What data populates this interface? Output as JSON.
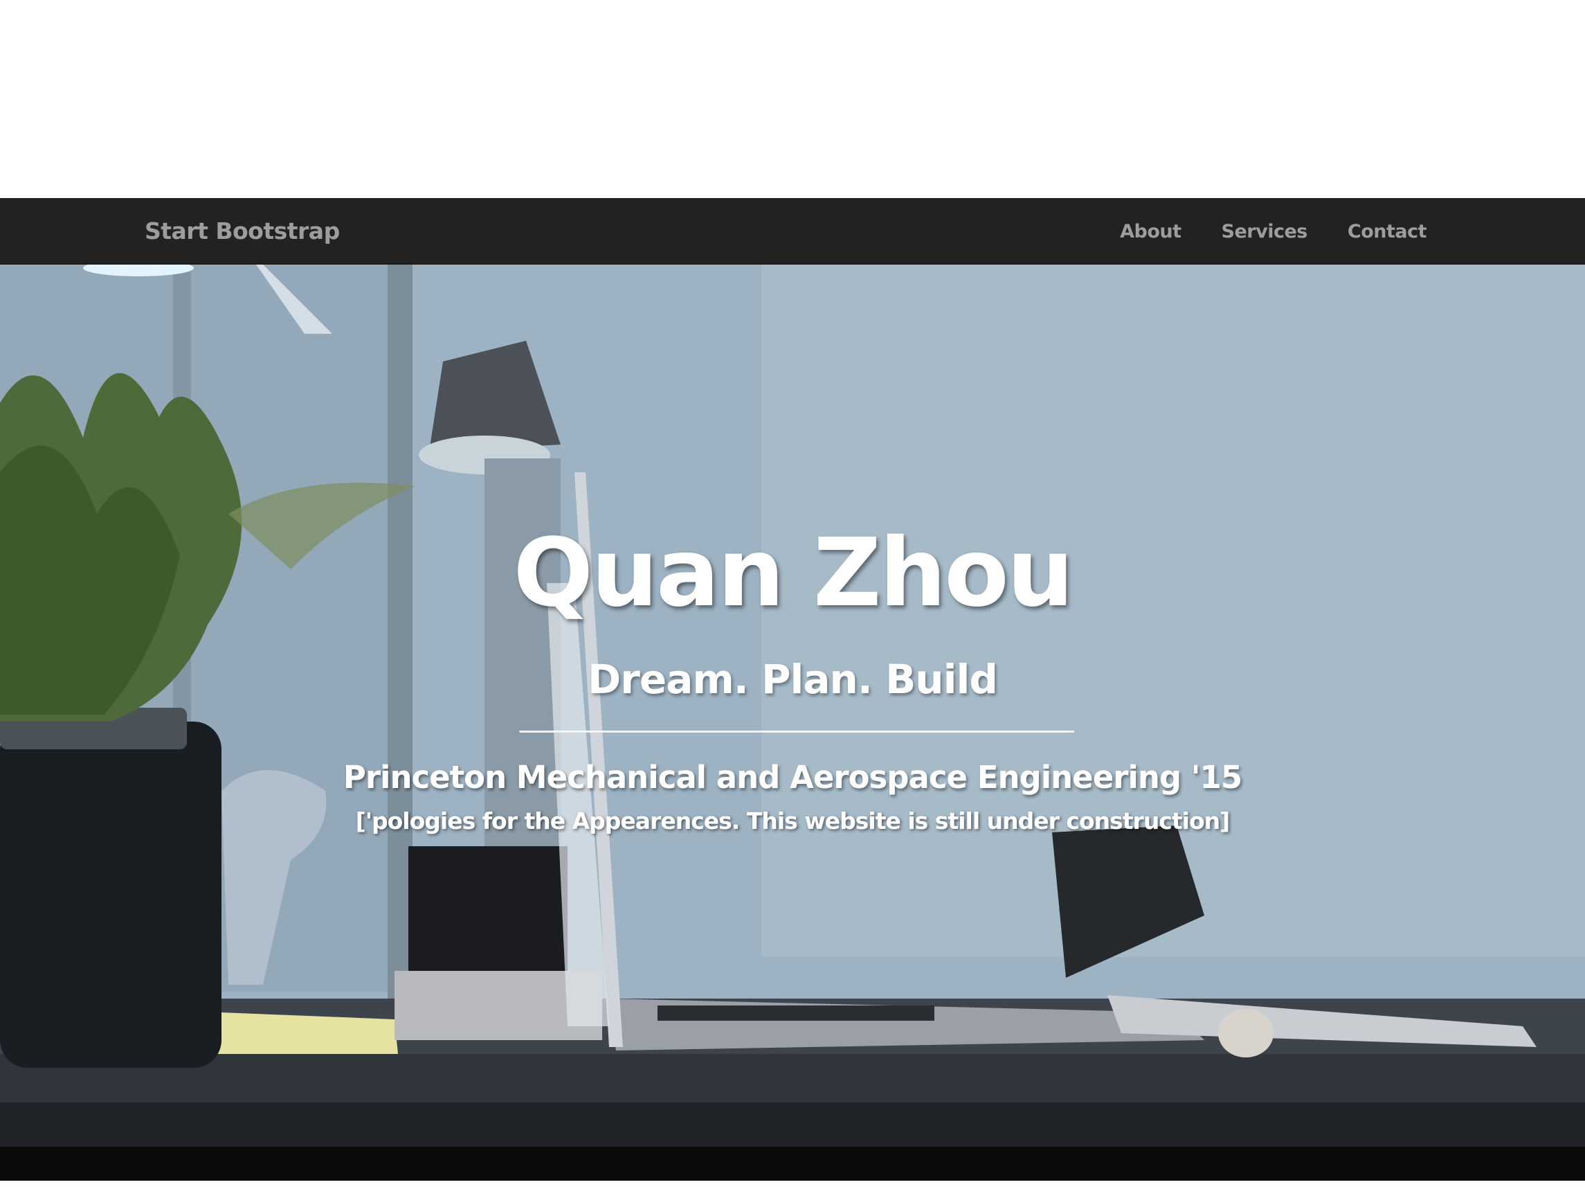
{
  "navbar": {
    "brand": "Start Bootstrap",
    "links": [
      {
        "label": "About"
      },
      {
        "label": "Services"
      },
      {
        "label": "Contact"
      }
    ],
    "background": "#222222",
    "text_color": "#9d9d9d"
  },
  "hero": {
    "title": "Quan Zhou",
    "tagline": "Dream. Plan. Build",
    "school": "Princeton Mechanical and Aerospace Engineering '15",
    "note": "['pologies for the Appearences. This website is still under construction]",
    "background_image": "desk-with-laptop-and-plant-photo"
  }
}
